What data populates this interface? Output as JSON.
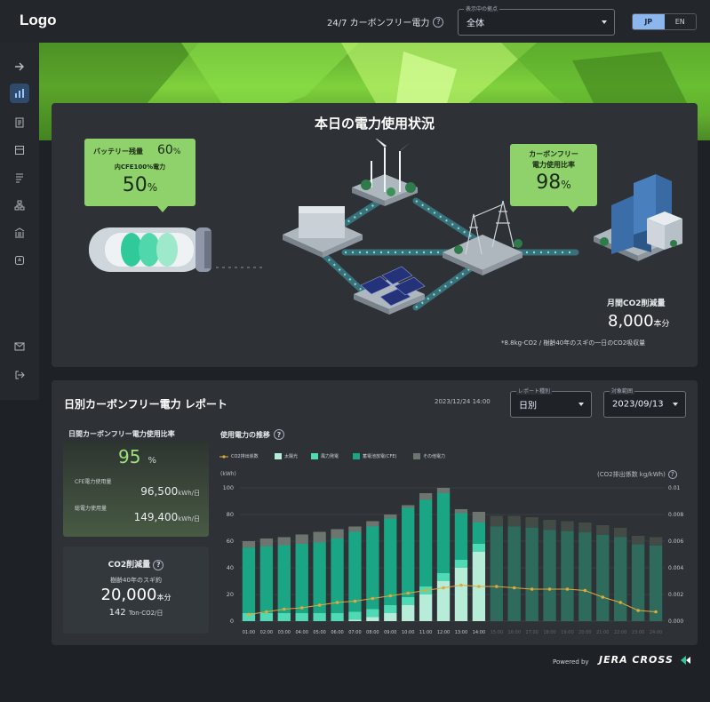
{
  "header": {
    "logo": "Logo",
    "cfe_link": "24/7 カーボンフリー電力",
    "viewpoint": {
      "legend": "表示中の拠点",
      "value": "全体"
    },
    "lang": {
      "jp": "JP",
      "en": "EN",
      "active": "JP"
    }
  },
  "sidebar": {
    "items": [
      "arrow-right-icon",
      "bar-chart-icon",
      "document-icon",
      "report-icon",
      "list-icon",
      "org-icon",
      "building-icon",
      "plug-icon",
      "mail-icon",
      "logout-icon"
    ],
    "active": "bar-chart-icon"
  },
  "status": {
    "title": "本日の電力使用状況",
    "battery": {
      "label": "バッテリー残量",
      "pct": "60",
      "unit": "%",
      "cfe_label": "内CFE100%電力",
      "cfe_pct": "50",
      "cfe_unit": "%"
    },
    "cfe_ratio": {
      "label1": "カーボンフリー",
      "label2": "電力使用比率",
      "pct": "98",
      "unit": "%"
    },
    "monthly": {
      "label": "月間CO2削減量",
      "value": "8,000",
      "unit": "本分",
      "note": "*8.8kg-CO2 / 樹齢40年のスギの一日のCO2吸収量"
    }
  },
  "report": {
    "title": "日別カーボンフリー電力 レポート",
    "timestamp": "2023/12/24 14:00",
    "type_select": {
      "legend": "レポート種別",
      "value": "日別"
    },
    "date_select": {
      "legend": "対象範囲",
      "value": "2023/09/13"
    },
    "daily_ratio": {
      "label": "日間カーボンフリー電力使用比率",
      "value": "95",
      "unit": "%",
      "cfe_label": "CFE電力使用量",
      "cfe_value": "96,500",
      "cfe_unit": "kWh/日",
      "total_label": "総電力使用量",
      "total_value": "149,400",
      "total_unit": "kWh/日"
    },
    "co2": {
      "label": "CO2削減量",
      "sub": "樹齢40年のスギ約",
      "value": "20,000",
      "unit": "本分",
      "tons": "142",
      "tons_unit": "Ton-CO2/日"
    },
    "chart_heading": "使用電力の推移",
    "left_axis_label": "(kWh)",
    "right_axis_label": "(CO2排出係数 kg/kWh)",
    "legend": {
      "co2": "CO2排出係数",
      "solar": "太陽光",
      "wind": "風力発電",
      "storage": "蓄電池放電(CFE)",
      "other": "その他電力"
    }
  },
  "footer": {
    "powered": "Powered by",
    "brand": "JERA CROSS"
  },
  "chart_data": {
    "type": "bar",
    "categories": [
      "01:00",
      "02:00",
      "03:00",
      "04:00",
      "05:00",
      "06:00",
      "07:00",
      "08:00",
      "09:00",
      "10:00",
      "11:00",
      "12:00",
      "13:00",
      "14:00",
      "15:00",
      "16:00",
      "17:00",
      "18:00",
      "19:00",
      "20:00",
      "21:00",
      "22:00",
      "23:00",
      "24:00"
    ],
    "ylim": [
      0,
      100
    ],
    "y2lim": [
      0,
      0.01
    ],
    "yticks": [
      0,
      20,
      40,
      60,
      80,
      100
    ],
    "y2ticks": [
      "0.000",
      "0.002",
      "0.004",
      "0.006",
      "0.008",
      "0.01"
    ],
    "series": [
      {
        "name": "太陽光",
        "color": "#b7ecd9",
        "values": [
          0,
          0,
          0,
          0,
          0,
          0,
          1,
          3,
          6,
          12,
          20,
          30,
          40,
          52,
          0,
          0,
          0,
          0,
          0,
          0,
          0,
          0,
          0,
          0
        ]
      },
      {
        "name": "風力発電",
        "color": "#4fd9b4",
        "values": [
          6,
          6,
          6,
          6,
          6,
          6,
          6,
          6,
          6,
          6,
          6,
          6,
          6,
          6,
          0,
          0,
          0,
          0,
          0,
          0,
          0,
          0,
          0,
          0
        ]
      },
      {
        "name": "蓄電池放電(CFE)",
        "color": "#1aa684",
        "values": [
          49,
          50,
          51,
          52,
          53,
          56,
          60,
          62,
          65,
          67,
          65,
          60,
          35,
          16,
          0,
          0,
          0,
          0,
          0,
          0,
          0,
          0,
          0,
          0
        ]
      },
      {
        "name": "その他電力",
        "color": "#6c756f",
        "values": [
          5,
          6,
          6,
          7,
          8,
          7,
          4,
          4,
          3,
          2,
          5,
          4,
          3,
          8,
          0,
          0,
          0,
          0,
          0,
          0,
          0,
          0,
          0,
          0
        ]
      }
    ],
    "ghost_totals": [
      0,
      0,
      0,
      0,
      0,
      0,
      0,
      0,
      0,
      0,
      0,
      0,
      0,
      0,
      79,
      79,
      78,
      76,
      75,
      74,
      72,
      70,
      64,
      63
    ],
    "co2_line": [
      0.0005,
      0.0007,
      0.0009,
      0.001,
      0.0012,
      0.0014,
      0.0015,
      0.0017,
      0.0019,
      0.0021,
      0.0023,
      0.0025,
      0.0027,
      0.0026,
      0.0026,
      0.0025,
      0.0024,
      0.0024,
      0.0024,
      0.0023,
      0.0018,
      0.0014,
      0.0008,
      0.0007
    ]
  }
}
